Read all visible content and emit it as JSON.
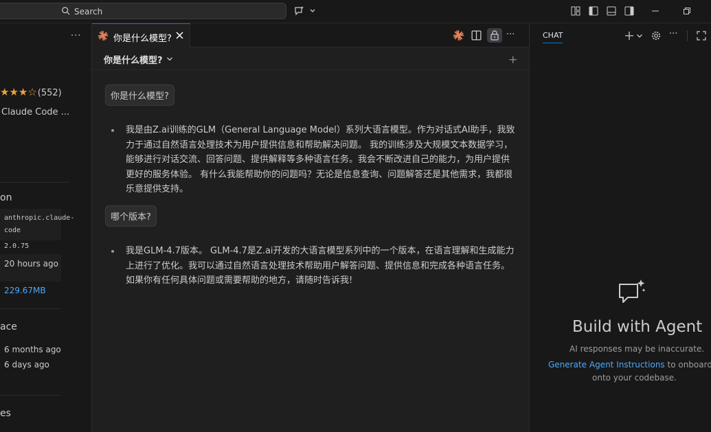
{
  "titlebar": {
    "search_label": "Search",
    "icons": [
      "copilot-icon",
      "chevron-down-icon",
      "layout-custom-icon",
      "toggle-primary-sidebar-icon",
      "toggle-panel-icon",
      "toggle-secondary-sidebar-icon",
      "minimize-icon",
      "restore-icon"
    ]
  },
  "left": {
    "more": "···",
    "rating_count": "(552)",
    "description": "Claude Code ...",
    "section1_heading": "on",
    "identifier": "anthropic.claude-code",
    "identifier_line1": "anthropic.claude-",
    "identifier_line2": "code",
    "version": "2.0.75",
    "last_updated": "20 hours ago",
    "size": "229.67MB",
    "section2_heading": "ace",
    "published": "6 months ago",
    "released": "6 days ago",
    "section3_heading": "es"
  },
  "editor": {
    "tab_title": "你是什么模型?",
    "session_title": "你是什么模型?",
    "messages": [
      {
        "role": "user",
        "text": "你是什么模型?"
      },
      {
        "role": "assistant",
        "text": "我是由Z.ai训练的GLM（General Language Model）系列大语言模型。作为对话式AI助手，我致力于通过自然语言处理技术为用户提供信息和帮助解决问题。 我的训练涉及大规模文本数据学习，能够进行对话交流、回答问题、提供解释等多种语言任务。我会不断改进自己的能力，为用户提供更好的服务体验。 有什么我能帮助你的问题吗？无论是信息查询、问题解答还是其他需求，我都很乐意提供支持。"
      },
      {
        "role": "user",
        "text": "哪个版本?"
      },
      {
        "role": "assistant",
        "text": "我是GLM-4.7版本。 GLM-4.7是Z.ai开发的大语言模型系列中的一个版本，在语言理解和生成能力上进行了优化。我可以通过自然语言处理技术帮助用户解答问题、提供信息和完成各种语言任务。 如果你有任何具体问题或需要帮助的地方，请随时告诉我!"
      }
    ]
  },
  "chat": {
    "tab": "CHAT",
    "heading": "Build with Agent",
    "subtitle": "AI responses may be inaccurate.",
    "link": "Generate Agent Instructions",
    "after_link": " to onboard A",
    "line3": "onto your codebase."
  },
  "colors": {
    "accent": "#0078d4",
    "link": "#4daafc",
    "star": "#e8a43b",
    "spark": "#e8825a"
  }
}
